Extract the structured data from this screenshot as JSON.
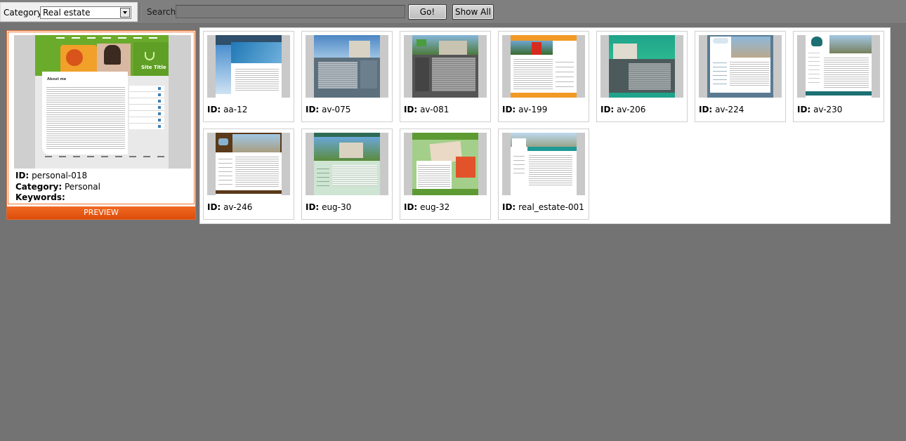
{
  "toolbar": {
    "category_label": "Category",
    "category_value": "Real estate",
    "search_label": "Search",
    "search_value": "",
    "go_label": "Go!",
    "show_all_label": "Show All"
  },
  "selected": {
    "id_label": "ID:",
    "id_value": "personal-018",
    "category_label": "Category:",
    "category_value": "Personal",
    "keywords_label": "Keywords:",
    "keywords_value": "",
    "preview_label": "PREVIEW",
    "thumb_site_title": "Site Title",
    "thumb_heading": "About me"
  },
  "templates": [
    {
      "id_label": "ID:",
      "id": "aa-12"
    },
    {
      "id_label": "ID:",
      "id": "av-075"
    },
    {
      "id_label": "ID:",
      "id": "av-081"
    },
    {
      "id_label": "ID:",
      "id": "av-199"
    },
    {
      "id_label": "ID:",
      "id": "av-206"
    },
    {
      "id_label": "ID:",
      "id": "av-224"
    },
    {
      "id_label": "ID:",
      "id": "av-230"
    },
    {
      "id_label": "ID:",
      "id": "av-246"
    },
    {
      "id_label": "ID:",
      "id": "eug-30"
    },
    {
      "id_label": "ID:",
      "id": "eug-32"
    },
    {
      "id_label": "ID:",
      "id": "real_estate-001"
    }
  ],
  "colors": {
    "background": "#737373",
    "accent": "#f0641e",
    "selected_border": "#e06a2c"
  }
}
